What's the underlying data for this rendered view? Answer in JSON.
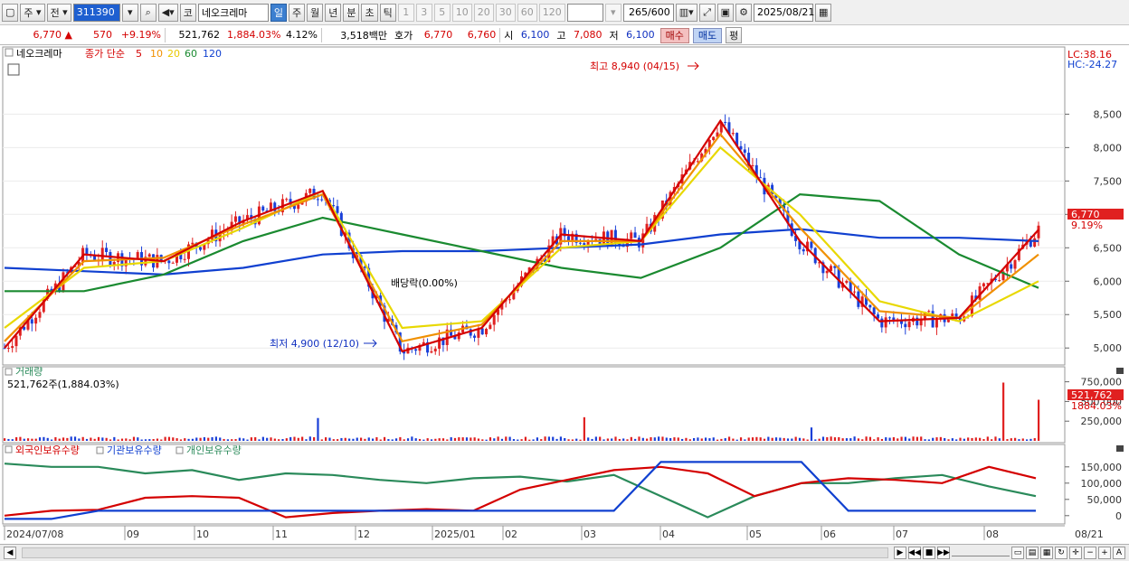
{
  "toolbar": {
    "period_primary": "주",
    "period_secondary": "전",
    "stock_code": "311390",
    "stock_name_btn": "코",
    "stock_name": "네오크레마",
    "periods": [
      "일",
      "주",
      "월",
      "년",
      "분",
      "초",
      "틱"
    ],
    "active_period": "일",
    "minute_options": [
      "1",
      "3",
      "5",
      "10",
      "20",
      "30",
      "60",
      "120"
    ],
    "count": "265",
    "count_total": "/600",
    "date": "2025/08/21"
  },
  "priceline": {
    "price": "6,770",
    "change_arrow": "▲",
    "change": "570",
    "change_pct": "+9.19%",
    "volume": "521,762",
    "volume_ratio": "1,884.03%",
    "turnover": "4.12%",
    "amount": "3,518백만",
    "quote_label": "호가",
    "ask": "6,770",
    "bid": "6,760",
    "open_label": "시",
    "open": "6,100",
    "high_label": "고",
    "high": "7,080",
    "low_label": "저",
    "low": "6,100",
    "buy_label": "매수",
    "sell_label": "매도",
    "eval_label": "평"
  },
  "price_panel": {
    "legend_name": "네오크레마",
    "legend_ma": "종가 단순",
    "ma_periods": [
      {
        "label": "5",
        "color": "#d40000"
      },
      {
        "label": "10",
        "color": "#f09000"
      },
      {
        "label": "20",
        "color": "#e8d800"
      },
      {
        "label": "60",
        "color": "#1a8a30"
      },
      {
        "label": "120",
        "color": "#1040d0"
      }
    ],
    "lc_label": "LC:38.16",
    "hc_label": "HC:-24.27",
    "high_annotation": "최고 8,940 (04/15)",
    "low_annotation": "최저 4,900 (12/10)",
    "rate_annotation": "배당락(0.00%)",
    "current_price_tag": "6,770",
    "current_pct_tag": "9.19%",
    "y_ticks": [
      "8,500",
      "8,000",
      "7,500",
      "7,000",
      "6,500",
      "6,000",
      "5,500",
      "5,000"
    ]
  },
  "volume_panel": {
    "title": "거래량",
    "value_text": "521,762주(1,884.03%)",
    "y_ticks": [
      "750,000",
      "500,000",
      "250,000"
    ],
    "current_tag": "521,762",
    "current_pct_tag": "1884.03%"
  },
  "holdings_panel": {
    "series": [
      {
        "name": "외국인보유수량",
        "color": "#d40000"
      },
      {
        "name": "기관보유수량",
        "color": "#1040d0"
      },
      {
        "name": "개인보유수량",
        "color": "#2a8a5a"
      }
    ],
    "y_ticks": [
      "150,000",
      "100,000",
      "50,000",
      "0"
    ]
  },
  "x_axis": {
    "labels": [
      "2024/07/08",
      "09",
      "10",
      "11",
      "12",
      "2025/01",
      "02",
      "03",
      "04",
      "05",
      "06",
      "07",
      "08"
    ],
    "right_label": "08/21"
  },
  "chart_data": {
    "type": "line",
    "title": "네오크레마",
    "ylabel": "",
    "ylim": [
      4800,
      9100
    ],
    "x": [
      "2024/07",
      "2024/08",
      "2024/09",
      "2024/10",
      "2024/11",
      "2024/12",
      "2025/01",
      "2025/02",
      "2025/03",
      "2025/04",
      "2025/05",
      "2025/06",
      "2025/07",
      "2025/08"
    ],
    "series": [
      {
        "name": "5",
        "values": [
          5000,
          6400,
          6300,
          6900,
          7350,
          4950,
          5300,
          6700,
          6600,
          8400,
          6600,
          5400,
          5450,
          6770
        ]
      },
      {
        "name": "10",
        "values": [
          5100,
          6300,
          6350,
          6850,
          7300,
          5100,
          5350,
          6600,
          6600,
          8200,
          6800,
          5550,
          5450,
          6400
        ]
      },
      {
        "name": "20",
        "values": [
          5300,
          6200,
          6300,
          6800,
          7350,
          5300,
          5400,
          6500,
          6600,
          8000,
          7000,
          5700,
          5400,
          6000
        ]
      },
      {
        "name": "60",
        "values": [
          5850,
          5850,
          6100,
          6600,
          6950,
          6700,
          6450,
          6200,
          6050,
          6500,
          7300,
          7200,
          6400,
          5900
        ]
      },
      {
        "name": "120",
        "values": [
          6200,
          6150,
          6100,
          6200,
          6400,
          6450,
          6450,
          6500,
          6550,
          6700,
          6780,
          6650,
          6650,
          6600
        ]
      }
    ]
  }
}
